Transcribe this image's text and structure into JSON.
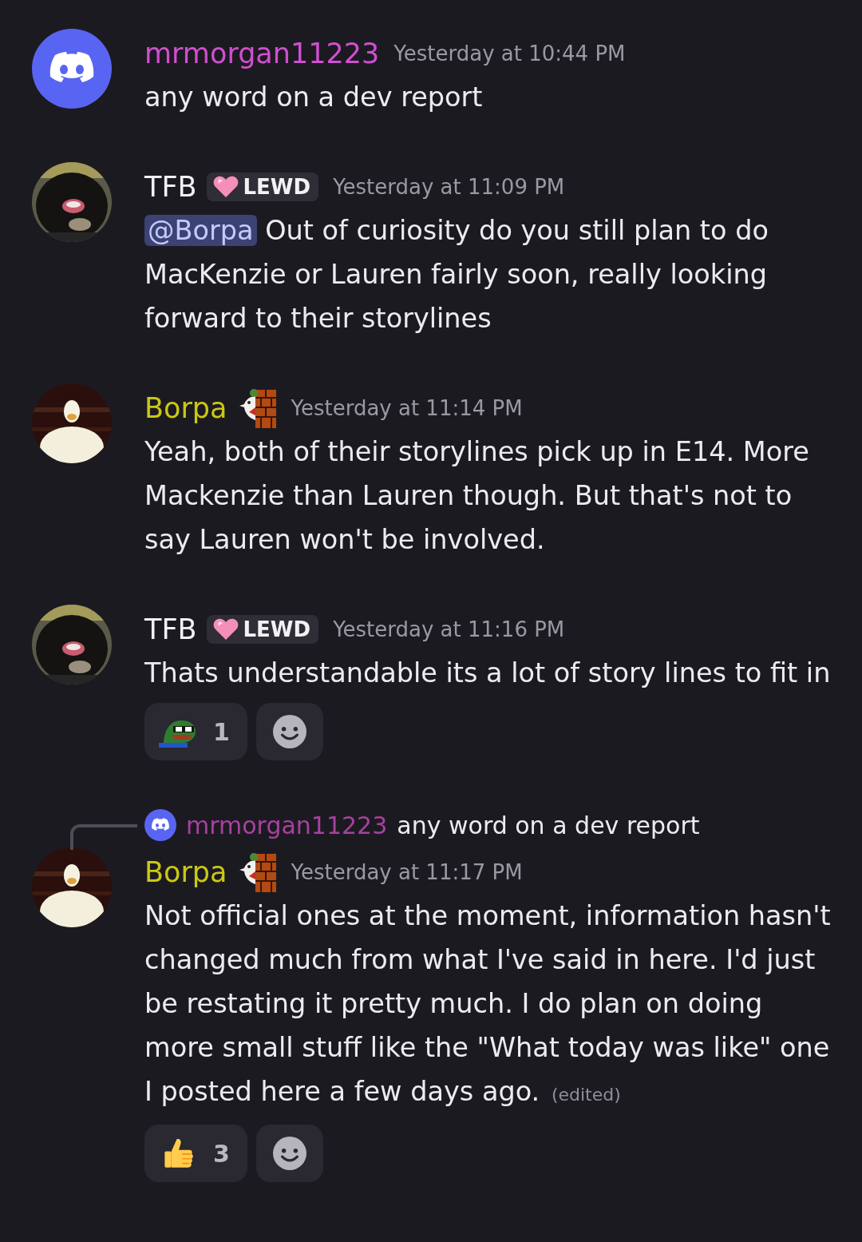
{
  "messages": [
    {
      "author": "mrmorgan11223",
      "color": "#d04fcf",
      "avatar": {
        "kind": "logo"
      },
      "timestamp": "Yesterday at 10:44 PM",
      "text": "any word on a dev report"
    },
    {
      "author": "TFB",
      "color": "#f2f2f4",
      "badge": {
        "label": "LEWD"
      },
      "timestamp": "Yesterday at 11:09 PM",
      "mention": "@Borpa",
      "text": "Out of curiosity do you still plan to do MacKenzie or Lauren fairly soon, really looking forward to their storylines"
    },
    {
      "author": "Borpa",
      "color": "#cbc813",
      "role_icon": true,
      "timestamp": "Yesterday at 11:14 PM",
      "text": "Yeah, both of their storylines pick up in E14. More Mackenzie than Lauren though. But that's not to say Lauren won't be involved."
    },
    {
      "author": "TFB",
      "color": "#f2f2f4",
      "badge": {
        "label": "LEWD"
      },
      "timestamp": "Yesterday at 11:16 PM",
      "text": "Thats understandable its a lot of story lines to fit in",
      "reactions": [
        {
          "kind": "frog",
          "count": "1"
        }
      ],
      "add_reaction": true
    },
    {
      "reply": {
        "author": "mrmorgan11223",
        "color": "#a8409f",
        "text": "any word on a dev report"
      },
      "author": "Borpa",
      "color": "#cbc813",
      "role_icon": true,
      "timestamp": "Yesterday at 11:17 PM",
      "text": "Not official ones at the moment, information hasn't changed much from what I've said in here. I'd just be restating it pretty much. I do plan on doing more small stuff like the \"What today was like\" one I posted here a few days ago.",
      "edited": "(edited)",
      "reactions": [
        {
          "kind": "thumbs",
          "count": "3"
        }
      ],
      "add_reaction": true
    }
  ]
}
